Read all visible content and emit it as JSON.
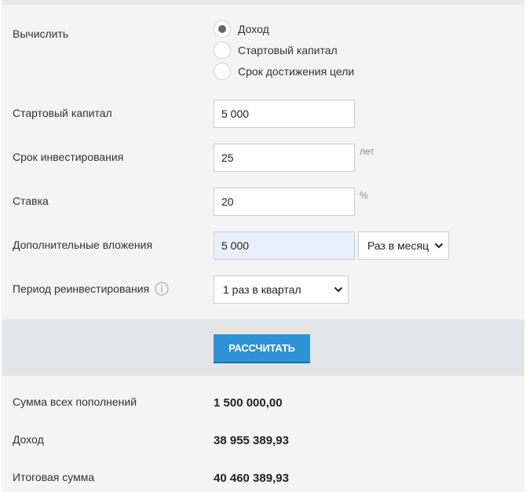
{
  "calculate": {
    "label": "Вычислить",
    "options": [
      {
        "label": "Доход",
        "checked": true
      },
      {
        "label": "Стартовый капитал",
        "checked": false
      },
      {
        "label": "Срок достижения цели",
        "checked": false
      }
    ]
  },
  "fields": {
    "start_capital": {
      "label": "Стартовый капитал",
      "value": "5 000"
    },
    "term": {
      "label": "Срок инвестирования",
      "value": "25",
      "unit": "лет"
    },
    "rate": {
      "label": "Ставка",
      "value": "20",
      "unit": "%"
    },
    "additional": {
      "label": "Дополнительные вложения",
      "value": "5 000",
      "frequency": "Раз в месяц"
    },
    "reinvest": {
      "label": "Период реинвестирования",
      "value": "1 раз в квартал"
    }
  },
  "calculate_button": "РАССЧИТАТЬ",
  "results": [
    {
      "label": "Сумма всех пополнений",
      "value": "1 500 000,00"
    },
    {
      "label": "Доход",
      "value": "38 955 389,93"
    },
    {
      "label": "Итоговая сумма",
      "value": "40 460 389,93"
    }
  ],
  "icons": {
    "info": "info-icon",
    "dropdown": "chevron-down-icon"
  },
  "colors": {
    "accent": "#2e93d6",
    "panel": "#f4f4f4",
    "band": "#e3e6e8",
    "highlight_field": "#e8f0fe"
  }
}
